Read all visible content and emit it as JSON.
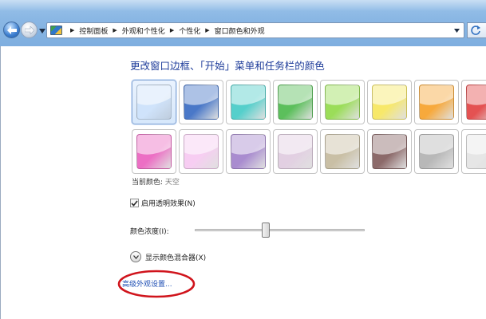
{
  "breadcrumb": [
    "控制面板",
    "外观和个性化",
    "个性化",
    "窗口颜色和外观"
  ],
  "page": {
    "title": "更改窗口边框、「开始」菜单和任务栏的颜色",
    "current_color_label": "当前颜色:",
    "current_color_value": "天空",
    "transparency_label": "启用透明效果(N)",
    "transparency_checked": true,
    "intensity_label": "颜色浓度(I):",
    "intensity_value": 0.42,
    "mixer_label": "显示颜色混合器(X)",
    "advanced_link": "高级外观设置..."
  },
  "swatches": [
    {
      "color": "#cfe3fb",
      "selected": true
    },
    {
      "color": "#4a78c8",
      "selected": false
    },
    {
      "color": "#55cfcb",
      "selected": false
    },
    {
      "color": "#5cbf5c",
      "selected": false
    },
    {
      "color": "#9bdd59",
      "selected": false
    },
    {
      "color": "#f7e86a",
      "selected": false
    },
    {
      "color": "#f7a93c",
      "selected": false
    },
    {
      "color": "#e45252",
      "selected": false
    },
    {
      "color": "#ec6fc4",
      "selected": false
    },
    {
      "color": "#f7cdf2",
      "selected": false
    },
    {
      "color": "#a98ccf",
      "selected": false
    },
    {
      "color": "#e2cfe2",
      "selected": false
    },
    {
      "color": "#c9bfa5",
      "selected": false
    },
    {
      "color": "#8c6a6a",
      "selected": false
    },
    {
      "color": "#b8b8b8",
      "selected": false
    },
    {
      "color": "#e6e6e6",
      "selected": false
    }
  ],
  "colors": {
    "title_blue": "#1e3c9a",
    "link_blue": "#1f4fb4",
    "annotation_red": "#d0141c"
  },
  "icons": [
    "back-arrow-icon",
    "forward-arrow-icon",
    "control-panel-icon",
    "refresh-icon",
    "chevron-down-icon"
  ]
}
